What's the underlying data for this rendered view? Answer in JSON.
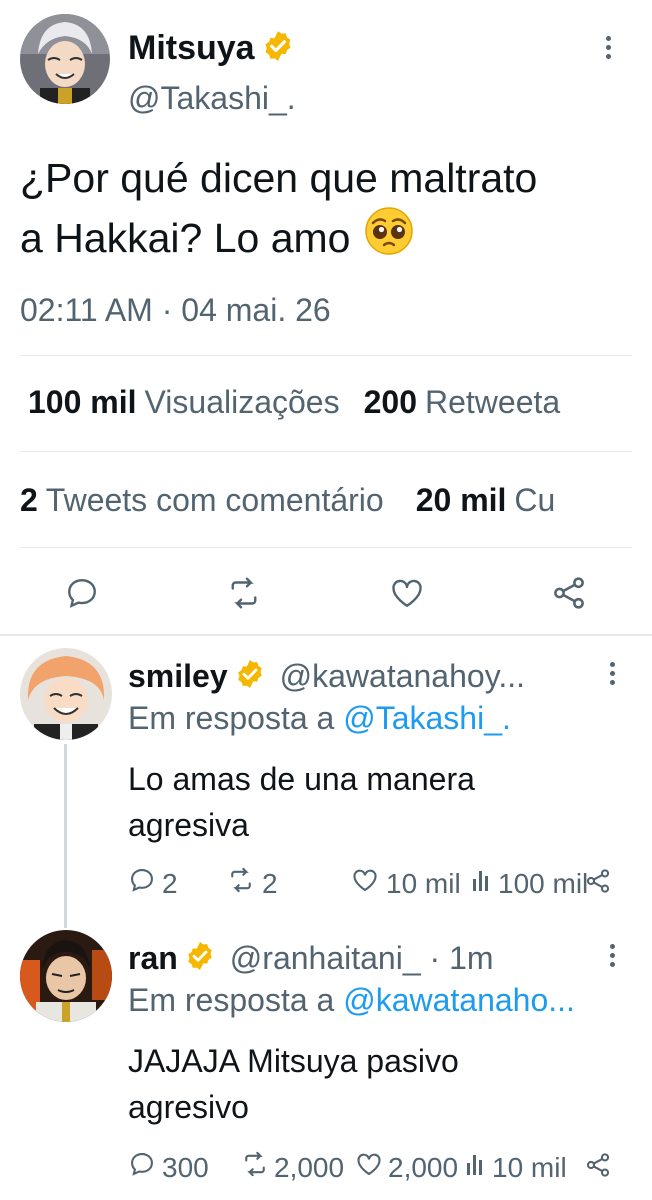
{
  "main_tweet": {
    "display_name": "Mitsuya",
    "handle": "@Takashi_.",
    "text_line1": "¿Por qué dicen que maltrato",
    "text_line2": "a Hakkai? Lo amo",
    "emoji": "🥺",
    "timestamp": "02:11 AM · 04 mai. 26",
    "stats_row1": [
      {
        "count": "100 mil",
        "label": "Visualizações"
      },
      {
        "count": "200",
        "label": "Retweeta"
      }
    ],
    "stats_row2": [
      {
        "count": "2",
        "label": "Tweets com comentário"
      },
      {
        "count": "20 mil",
        "label": "Cu"
      }
    ]
  },
  "replies": [
    {
      "display_name": "smiley",
      "handle": "@kawatanahoy...",
      "in_reply_prefix": "Em resposta a ",
      "in_reply_to": "@Takashi_.",
      "text_line1": "Lo amas de una manera",
      "text_line2": "agresiva",
      "replies": "2",
      "retweets": "2",
      "likes": "10 mil",
      "views": "100 mil"
    },
    {
      "display_name": "ran",
      "handle": "@ranhaitani_ · 1m",
      "in_reply_prefix": "Em resposta a ",
      "in_reply_to": "@kawatanaho...",
      "text_line1": "JAJAJA Mitsuya pasivo",
      "text_line2": "agresivo",
      "replies": "300",
      "retweets": "2,000",
      "likes": "2,000",
      "views": "10 mil"
    }
  ],
  "colors": {
    "text": "#0f1419",
    "muted": "#536471",
    "link": "#1d9bf0",
    "badge": "#f5b700"
  }
}
